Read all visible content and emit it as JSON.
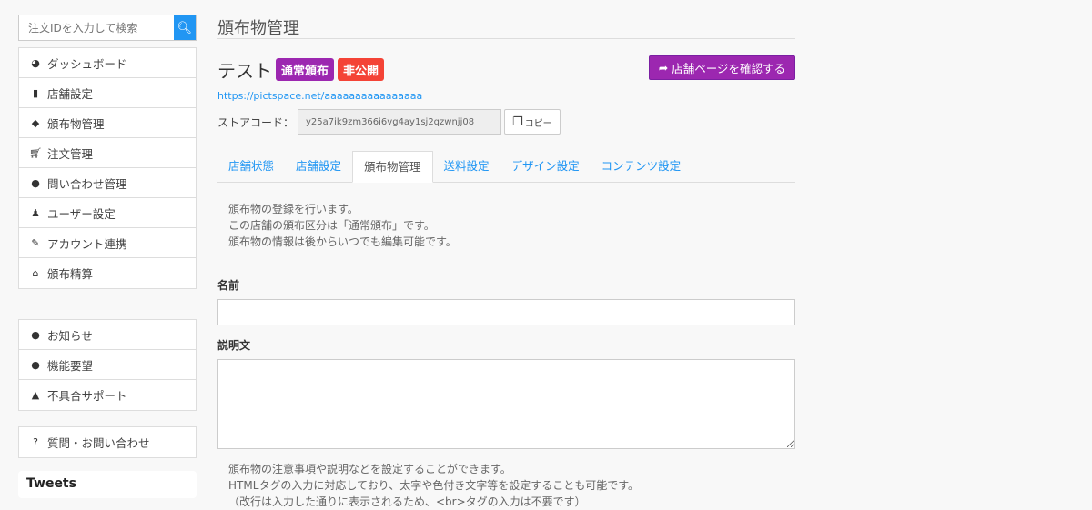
{
  "sidebar": {
    "search_placeholder": "注文IDを入力して検索",
    "menu": [
      "ダッシュボード",
      "店舗設定",
      "頒布物管理",
      "注文管理",
      "問い合わせ管理",
      "ユーザー設定",
      "アカウント連携",
      "頒布精算"
    ],
    "info": [
      "お知らせ",
      "機能要望",
      "不具合サポート"
    ],
    "help": "質問・お問い合わせ",
    "tweets": "Tweets"
  },
  "main": {
    "page_title": "頒布物管理",
    "store_name": "テスト",
    "badge_type": "通常頒布",
    "badge_status": "非公開",
    "view_button": "店舗ページを確認する",
    "url": "https://pictspace.net/aaaaaaaaaaaaaaaa",
    "store_code_label": "ストアコード：",
    "store_code": "y25a7ik9zm366i6vg4ay1sj2qzwnjj08",
    "copy_button": "コピー",
    "tabs": [
      "店舗状態",
      "店舗設定",
      "頒布物管理",
      "送料設定",
      "デザイン設定",
      "コンテンツ設定"
    ],
    "desc": [
      "頒布物の登録を行います。",
      "この店舗の頒布区分は「通常頒布」です。",
      "頒布物の情報は後からいつでも編集可能です。"
    ],
    "name_label": "名前",
    "name_value": "",
    "desc_label": "説明文",
    "desc_value": "",
    "note": [
      "頒布物の注意事項や説明などを設定することができます。",
      "HTMLタグの入力に対応しており、太字や色付き文字等を設定することも可能です。",
      "（改行は入力した通りに表示されるため、<br>タグの入力は不要です）"
    ]
  },
  "colors": {
    "accent": "#2196f3",
    "purple": "#9c27b0",
    "red": "#f44336"
  }
}
